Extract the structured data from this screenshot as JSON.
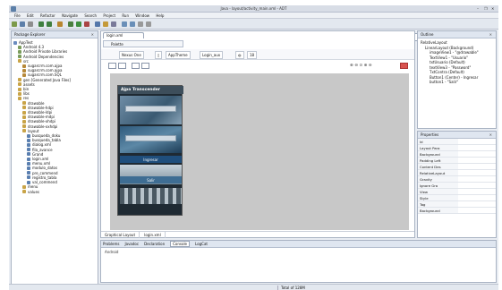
{
  "window": {
    "title": "Java - layout/activity_main.xml - ADT",
    "controls": [
      "–",
      "❐",
      "✕"
    ]
  },
  "menu": [
    "File",
    "Edit",
    "Refactor",
    "Navigate",
    "Search",
    "Project",
    "Run",
    "Window",
    "Help"
  ],
  "toolbar": {
    "quick_access_placeholder": "Quick Access",
    "perspectives": [
      "Java",
      "DDMS"
    ]
  },
  "package_explorer": {
    "title": "Package Explorer",
    "tree": [
      {
        "label": "AppTest",
        "depth": 0,
        "icon": "project-icon",
        "color": "#6b8cbf"
      },
      {
        "label": "Android 4.3",
        "depth": 1,
        "icon": "library-icon",
        "color": "#7a9c5b"
      },
      {
        "label": "Android Private Libraries",
        "depth": 1,
        "icon": "library-icon",
        "color": "#7a9c5b"
      },
      {
        "label": "Android Dependencies",
        "depth": 1,
        "icon": "library-icon",
        "color": "#7a9c5b"
      },
      {
        "label": "src",
        "depth": 1,
        "icon": "folder-icon",
        "color": "#c9a448"
      },
      {
        "label": "sugarcrm.com.ajpa",
        "depth": 2,
        "icon": "package-icon",
        "color": "#b7893a"
      },
      {
        "label": "sugarcrm.com.ajpa",
        "depth": 2,
        "icon": "package-icon",
        "color": "#b7893a"
      },
      {
        "label": "sugarcrm.com.SQL",
        "depth": 2,
        "icon": "package-icon",
        "color": "#b7893a"
      },
      {
        "label": "gen [Generated Java Files]",
        "depth": 1,
        "icon": "folder-icon",
        "color": "#c9a448"
      },
      {
        "label": "assets",
        "depth": 1,
        "icon": "folder-icon",
        "color": "#c9a448"
      },
      {
        "label": "bin",
        "depth": 1,
        "icon": "folder-icon",
        "color": "#c9a448"
      },
      {
        "label": "libs",
        "depth": 1,
        "icon": "folder-icon",
        "color": "#c9a448"
      },
      {
        "label": "res",
        "depth": 1,
        "icon": "folder-icon",
        "color": "#c9a448"
      },
      {
        "label": "drawable",
        "depth": 2,
        "icon": "folder-icon",
        "color": "#c9a448"
      },
      {
        "label": "drawable-hdpi",
        "depth": 2,
        "icon": "folder-icon",
        "color": "#c9a448"
      },
      {
        "label": "drawable-ldpi",
        "depth": 2,
        "icon": "folder-icon",
        "color": "#c9a448"
      },
      {
        "label": "drawable-mdpi",
        "depth": 2,
        "icon": "folder-icon",
        "color": "#c9a448"
      },
      {
        "label": "drawable-xhdpi",
        "depth": 2,
        "icon": "folder-icon",
        "color": "#c9a448"
      },
      {
        "label": "drawable-xxhdpi",
        "depth": 2,
        "icon": "folder-icon",
        "color": "#c9a448"
      },
      {
        "label": "layout",
        "depth": 2,
        "icon": "folder-icon",
        "color": "#c9a448"
      },
      {
        "label": "busqueda_doku",
        "depth": 3,
        "icon": "file-icon",
        "color": "#5a7fb0"
      },
      {
        "label": "busqueda_tabla",
        "depth": 3,
        "icon": "file-icon",
        "color": "#5a7fb0"
      },
      {
        "label": "dialog.xml",
        "depth": 3,
        "icon": "file-icon",
        "color": "#5a7fb0"
      },
      {
        "label": "fila_avance",
        "depth": 3,
        "icon": "file-icon",
        "color": "#5a7fb0"
      },
      {
        "label": "Grand",
        "depth": 3,
        "icon": "file-icon",
        "color": "#5a7fb0"
      },
      {
        "label": "login.xml",
        "depth": 3,
        "icon": "file-icon",
        "color": "#5a7fb0"
      },
      {
        "label": "menu.xml",
        "depth": 3,
        "icon": "file-icon",
        "color": "#5a7fb0"
      },
      {
        "label": "modulo_datos",
        "depth": 3,
        "icon": "file-icon",
        "color": "#5a7fb0"
      },
      {
        "label": "pre_commend",
        "depth": 3,
        "icon": "file-icon",
        "color": "#5a7fb0"
      },
      {
        "label": "registro_tabla",
        "depth": 3,
        "icon": "file-icon",
        "color": "#5a7fb0"
      },
      {
        "label": "val_commend",
        "depth": 3,
        "icon": "file-icon",
        "color": "#5a7fb0"
      },
      {
        "label": "menu",
        "depth": 2,
        "icon": "folder-icon",
        "color": "#c9a448"
      },
      {
        "label": "values",
        "depth": 2,
        "icon": "folder-icon",
        "color": "#c9a448"
      }
    ]
  },
  "editor": {
    "tab_label": "login.xml",
    "palette_label": "Palette",
    "device_label": "Nexus One",
    "theme_label": "AppTheme",
    "activity_label": "Login_aux",
    "api_label": "18",
    "zoom_icons": "⊕ ⊖ ⊙ ⊕ ⊖",
    "phone": {
      "app_title": "Ajpa Transcender",
      "button_label": "Ingresar",
      "button2_label": "Salir"
    },
    "bottom_tabs": [
      "Graphical Layout",
      "login.xml"
    ]
  },
  "outline": {
    "title": "Outline",
    "tree": [
      {
        "label": "RelativeLayout",
        "depth": 0
      },
      {
        "label": "LinearLayout (Background)",
        "depth": 1
      },
      {
        "label": "imageView1 - \"@drawable\"",
        "depth": 2
      },
      {
        "label": "TextView1 - \"Usuario\"",
        "depth": 2
      },
      {
        "label": "txtUsuario (Default)",
        "depth": 2
      },
      {
        "label": "textView3 - \"Password\"",
        "depth": 2
      },
      {
        "label": "TxtContra (Default)",
        "depth": 2
      },
      {
        "label": "Button1 (Center) - Ingresar",
        "depth": 2
      },
      {
        "label": "button1 - \"Salir\"",
        "depth": 2
      }
    ]
  },
  "properties": {
    "title": "Properties",
    "rows": [
      {
        "k": "Id",
        "v": ""
      },
      {
        "k": "Layout Para",
        "v": ""
      },
      {
        "k": "Background",
        "v": ""
      },
      {
        "k": "Padding Left",
        "v": ""
      },
      {
        "k": "Content Des",
        "v": ""
      },
      {
        "k": "RelativeLayout",
        "v": ""
      },
      {
        "k": "Gravity",
        "v": ""
      },
      {
        "k": "Ignore Gra",
        "v": ""
      },
      {
        "k": "View",
        "v": ""
      },
      {
        "k": "Style",
        "v": ""
      },
      {
        "k": "Tag",
        "v": ""
      },
      {
        "k": "Background",
        "v": ""
      }
    ]
  },
  "console": {
    "tabs": [
      "Problems",
      "Javadoc",
      "Declaration",
      "Console",
      "LogCat"
    ],
    "active_tab": "Console",
    "body": "Android"
  },
  "status": {
    "memory": "Total of 128M"
  }
}
